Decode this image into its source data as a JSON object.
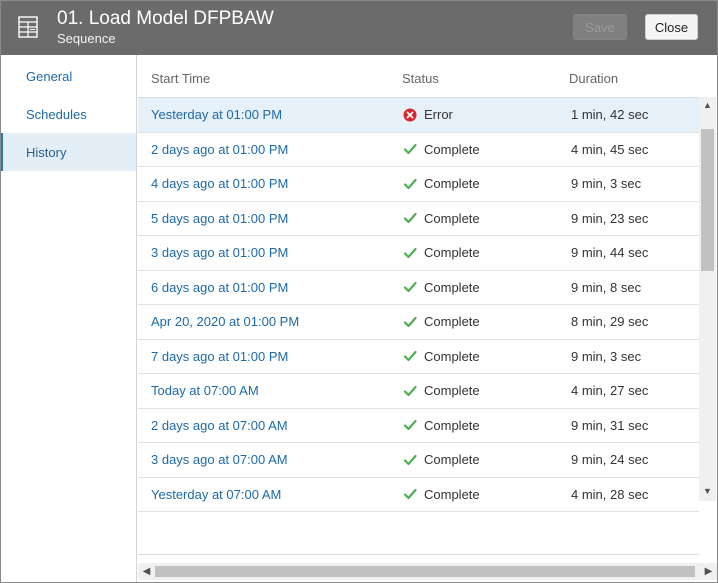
{
  "header": {
    "title": "01. Load Model DFPBAW",
    "subtitle": "Sequence",
    "icon": "sequence-icon",
    "save_label": "Save",
    "close_label": "Close"
  },
  "sidebar": {
    "items": [
      {
        "label": "General",
        "active": false
      },
      {
        "label": "Schedules",
        "active": false
      },
      {
        "label": "History",
        "active": true
      }
    ]
  },
  "history": {
    "columns": [
      "Start Time",
      "Status",
      "Duration"
    ],
    "rows": [
      {
        "start": "Yesterday at 01:00 PM",
        "status": "Error",
        "duration": "1 min, 42 sec"
      },
      {
        "start": "2 days ago at 01:00 PM",
        "status": "Complete",
        "duration": "4 min, 45 sec"
      },
      {
        "start": "4 days ago at 01:00 PM",
        "status": "Complete",
        "duration": "9 min, 3 sec"
      },
      {
        "start": "5 days ago at 01:00 PM",
        "status": "Complete",
        "duration": "9 min, 23 sec"
      },
      {
        "start": "3 days ago at 01:00 PM",
        "status": "Complete",
        "duration": "9 min, 44 sec"
      },
      {
        "start": "6 days ago at 01:00 PM",
        "status": "Complete",
        "duration": "9 min, 8 sec"
      },
      {
        "start": "Apr 20, 2020 at 01:00 PM",
        "status": "Complete",
        "duration": "8 min, 29 sec"
      },
      {
        "start": "7 days ago at 01:00 PM",
        "status": "Complete",
        "duration": "9 min, 3 sec"
      },
      {
        "start": "Today at 07:00 AM",
        "status": "Complete",
        "duration": "4 min, 27 sec"
      },
      {
        "start": "2 days ago at 07:00 AM",
        "status": "Complete",
        "duration": "9 min, 31 sec"
      },
      {
        "start": "3 days ago at 07:00 AM",
        "status": "Complete",
        "duration": "9 min, 24 sec"
      },
      {
        "start": "Yesterday at 07:00 AM",
        "status": "Complete",
        "duration": "4 min, 28 sec"
      }
    ]
  },
  "colors": {
    "header_bg": "#6b6b6b",
    "link": "#1d6aa8",
    "selected_row": "#e6f0f8",
    "success": "#4caf50",
    "error": "#d9262c"
  }
}
